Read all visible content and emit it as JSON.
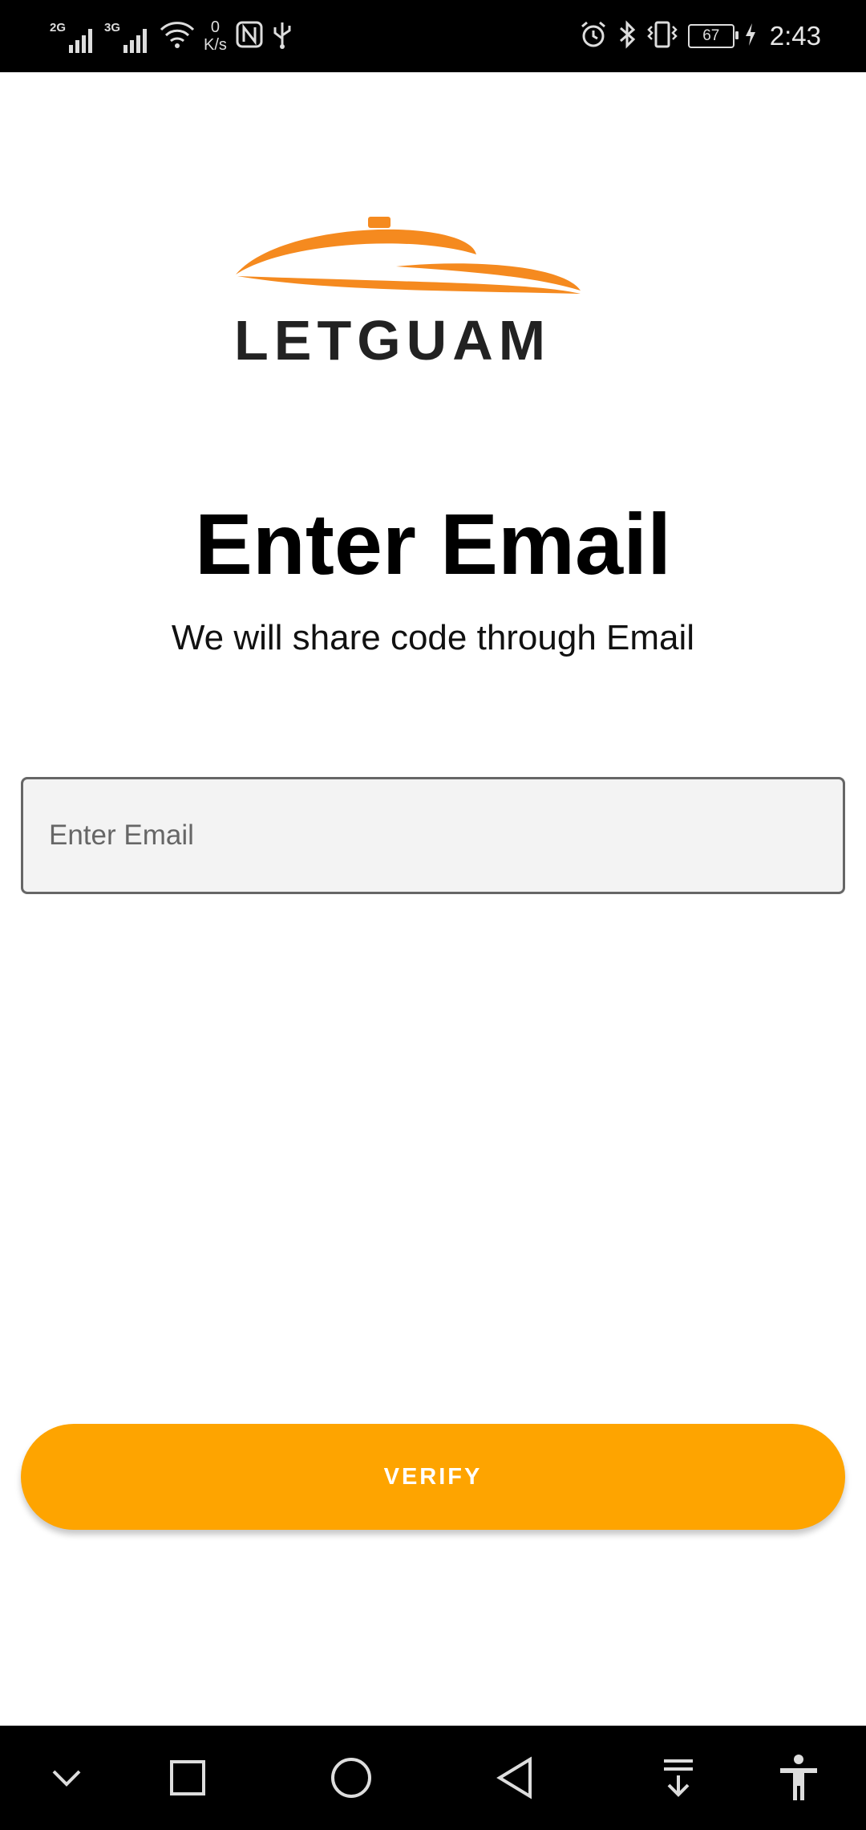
{
  "status_bar": {
    "network_1": "2G",
    "network_2": "3G",
    "speed_value": "0",
    "speed_unit": "K/s",
    "battery": "67",
    "time": "2:43",
    "icons": [
      "signal-icon",
      "wifi-icon",
      "nfc-icon",
      "usb-icon",
      "alarm-icon",
      "bluetooth-icon",
      "vibrate-icon",
      "battery-icon",
      "charging-icon"
    ]
  },
  "logo": {
    "text": "LETGUAM",
    "accent_color": "#f58a1f"
  },
  "main": {
    "title": "Enter Email",
    "subtitle": "We will share code through Email",
    "email_placeholder": "Enter Email",
    "email_value": "",
    "verify_label": "VERIFY",
    "button_color": "#fea400"
  },
  "nav_bar": {
    "icons": [
      "chevron-down-icon",
      "recents-square-icon",
      "home-circle-icon",
      "back-triangle-icon",
      "notification-pulldown-icon",
      "accessibility-icon"
    ]
  }
}
